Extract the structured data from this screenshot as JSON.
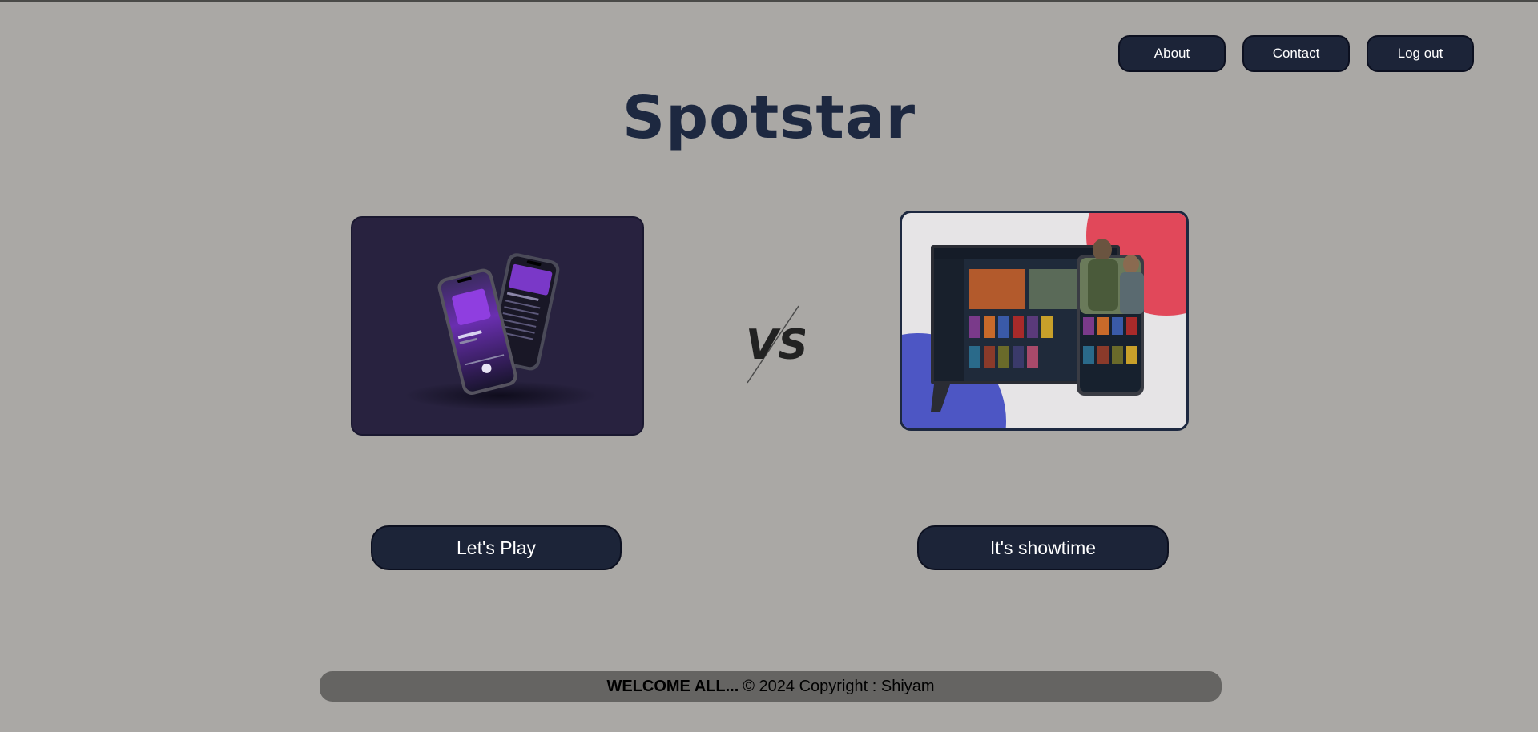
{
  "nav": {
    "about_label": "About",
    "contact_label": "Contact",
    "logout_label": "Log out"
  },
  "header": {
    "title": "Spotstar"
  },
  "versus": {
    "label": "VS"
  },
  "cards": {
    "music_image": "music-player-phones-image",
    "movie_image": "movie-streaming-tv-phone-image"
  },
  "actions": {
    "play_label": "Let's Play",
    "showtime_label": "It's showtime"
  },
  "footer": {
    "welcome": "WELCOME ALL...",
    "copyright": "© 2024 Copyright : Shiyam"
  },
  "colors": {
    "background": "#aaa8a5",
    "button": "#1c2438",
    "title": "#1d2840",
    "footer": "#656462"
  }
}
